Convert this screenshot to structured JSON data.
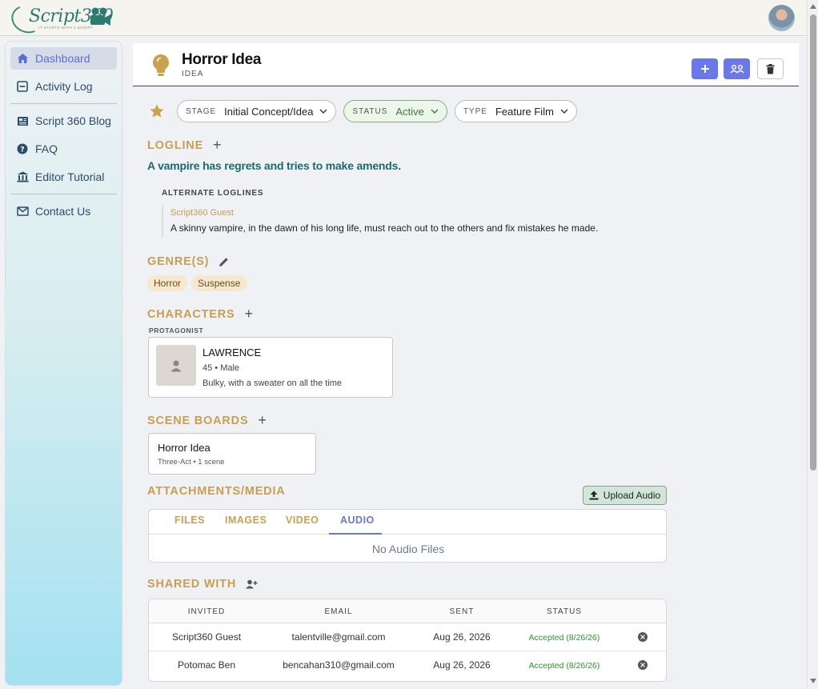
{
  "app": {
    "logo_text": "Script360",
    "logo_tagline": "IT STARTS WITH A SCRIPT"
  },
  "sidebar": {
    "items": [
      {
        "label": "Dashboard",
        "icon": "home-icon",
        "active": true
      },
      {
        "label": "Activity Log",
        "icon": "list-icon"
      },
      {
        "label": "Script 360 Blog",
        "icon": "newspaper-icon"
      },
      {
        "label": "FAQ",
        "icon": "question-icon"
      },
      {
        "label": "Editor Tutorial",
        "icon": "bank-icon"
      },
      {
        "label": "Contact Us",
        "icon": "mail-icon"
      }
    ]
  },
  "header": {
    "title": "Horror Idea",
    "subtitle": "IDEA",
    "icon": "lightbulb-icon"
  },
  "chips": {
    "stage_label": "STAGE",
    "stage_value": "Initial Concept/Idea",
    "status_label": "STATUS",
    "status_value": "Active",
    "type_label": "TYPE",
    "type_value": "Feature Film"
  },
  "logline": {
    "title": "LOGLINE",
    "text": "A vampire has regrets and tries to make amends.",
    "alt_heading": "ALTERNATE LOGLINES",
    "alternates": [
      {
        "author": "Script360 Guest",
        "text": "A skinny vampire, in the dawn of his long life, must reach out to the others and fix mistakes he made."
      }
    ]
  },
  "genres": {
    "title": "GENRE(S)",
    "tags": [
      "Horror",
      "Suspense"
    ]
  },
  "characters": {
    "title": "CHARACTERS",
    "role": "PROTAGONIST",
    "list": [
      {
        "name": "LAWRENCE",
        "meta": "45 • Male",
        "description": "Bulky, with a sweater on all the time"
      }
    ]
  },
  "scene_boards": {
    "title": "SCENE BOARDS",
    "list": [
      {
        "name": "Horror Idea",
        "meta": "Three-Act • 1 scene"
      }
    ]
  },
  "attachments": {
    "title": "ATTACHMENTS/MEDIA",
    "upload_label": "Upload Audio",
    "tabs": [
      "FILES",
      "IMAGES",
      "VIDEO",
      "AUDIO"
    ],
    "active_tab": "AUDIO",
    "empty_text": "No Audio Files"
  },
  "shared": {
    "title": "SHARED WITH",
    "columns": [
      "INVITED",
      "EMAIL",
      "SENT",
      "STATUS"
    ],
    "rows": [
      {
        "invited": "Script360 Guest",
        "email": "talentville@gmail.com",
        "sent": "Aug 26, 2026",
        "status": "Accepted (8/26/26)"
      },
      {
        "invited": "Potomac Ben",
        "email": "bencahan310@gmail.com",
        "sent": "Aug 26, 2026",
        "status": "Accepted (8/26/26)"
      }
    ]
  },
  "colors": {
    "accent": "#6a78e8",
    "section_gold": "#c79f52",
    "logline_teal": "#1b6b6b",
    "accepted_green": "#2f8f2f"
  }
}
